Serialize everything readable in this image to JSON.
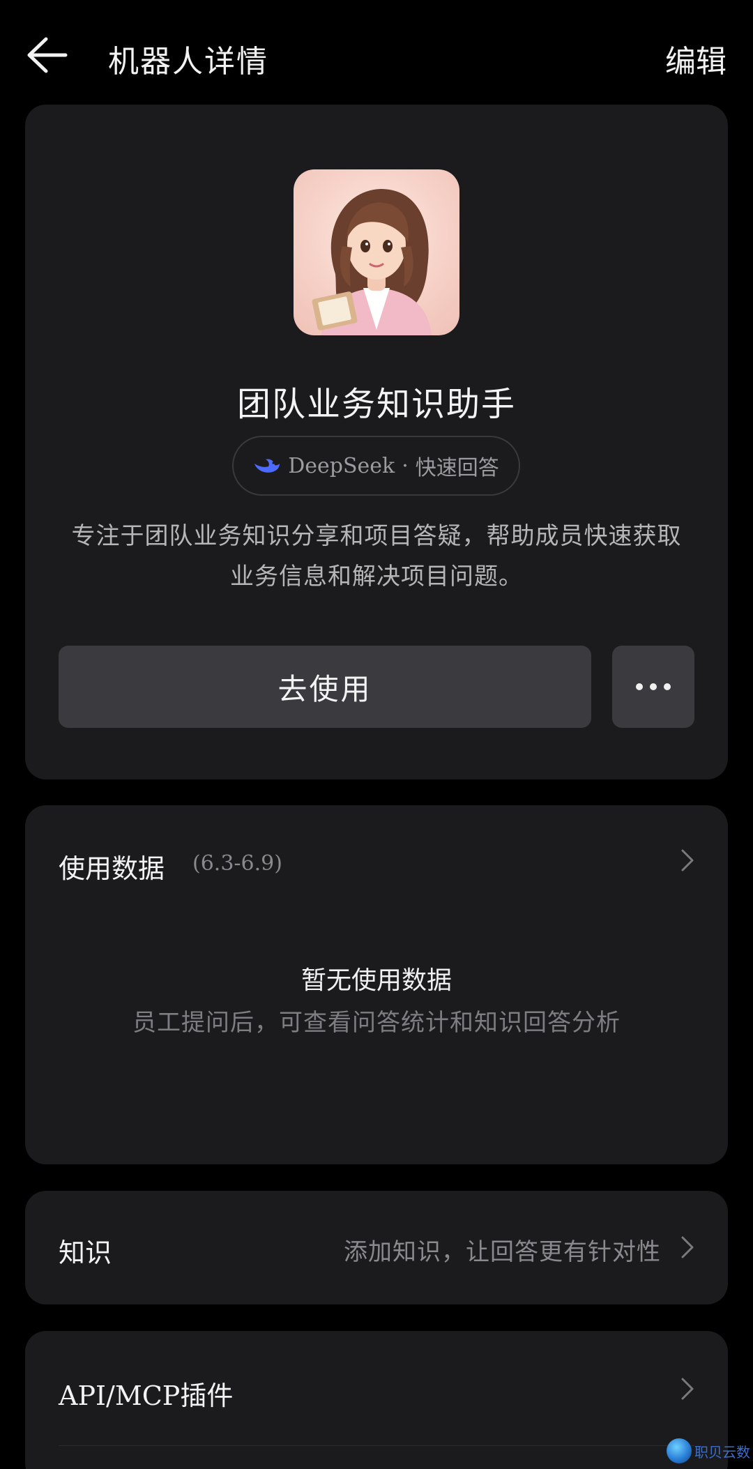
{
  "header": {
    "title": "机器人详情",
    "edit_label": "编辑"
  },
  "profile": {
    "name": "团队业务知识助手",
    "model_name": "DeepSeek",
    "model_separator": "·",
    "model_mode": "快速回答",
    "description": "专注于团队业务知识分享和项目答疑，帮助成员快速获取业务信息和解决项目问题。",
    "use_label": "去使用"
  },
  "usage": {
    "title": "使用数据",
    "range": "(6.3-6.9)",
    "empty_title": "暂无使用数据",
    "empty_desc": "员工提问后，可查看问答统计和知识回答分析"
  },
  "knowledge": {
    "label": "知识",
    "hint": "添加知识，让回答更有针对性"
  },
  "plugin": {
    "label": "API/MCP插件"
  },
  "watermark": {
    "text": "职贝云数"
  },
  "colors": {
    "background": "#000000",
    "card": "#1b1b1d",
    "button": "#3b3b3f",
    "deepseek_blue": "#4d6bfe"
  },
  "icons": {
    "back": "arrow-left-icon",
    "more": "more-horizontal-icon",
    "chevron": "chevron-right-icon",
    "model": "deepseek-whale-icon"
  }
}
